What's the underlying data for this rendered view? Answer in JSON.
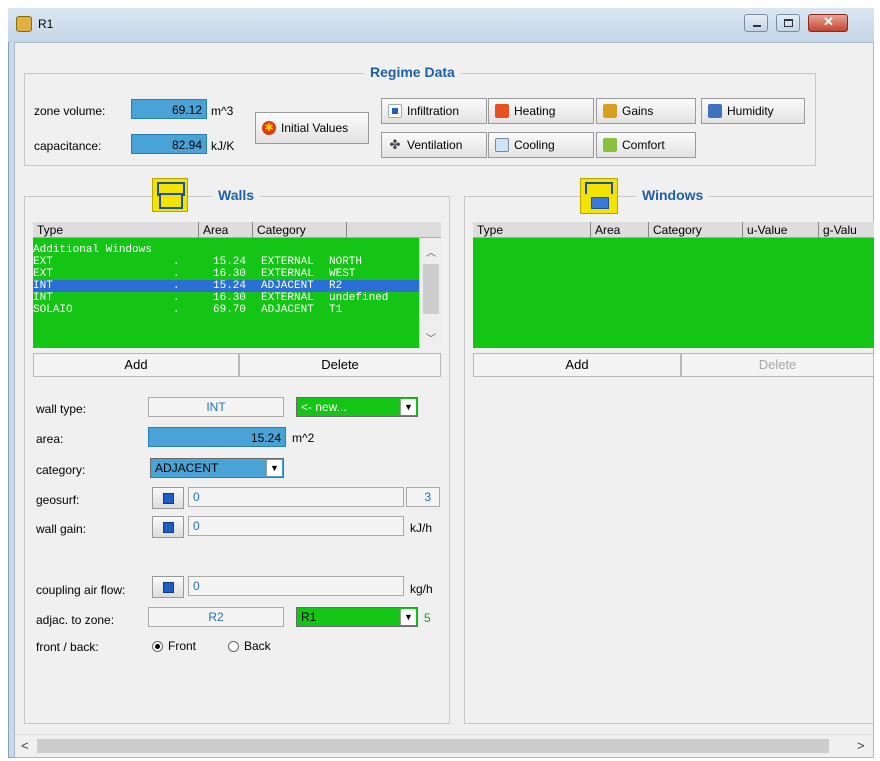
{
  "window": {
    "title": "R1"
  },
  "regime": {
    "legend": "Regime Data",
    "zone_volume_label": "zone volume:",
    "zone_volume_value": "69.12",
    "zone_volume_unit": "m^3",
    "capacitance_label": "capacitance:",
    "capacitance_value": "82.94",
    "capacitance_unit": "kJ/K",
    "initial_values": "Initial Values",
    "buttons": {
      "infiltration": "Infiltration",
      "heating": "Heating",
      "gains": "Gains",
      "humidity": "Humidity",
      "ventilation": "Ventilation",
      "cooling": "Cooling",
      "comfort": "Comfort"
    }
  },
  "walls": {
    "legend": "Walls",
    "columns": [
      "Type",
      "Area",
      "Category",
      ""
    ],
    "rows": [
      {
        "type": "Additional Windows",
        "dot": "",
        "area": "",
        "category": "",
        "extra": ""
      },
      {
        "type": "EXT",
        "dot": ".",
        "area": "15.24",
        "category": "EXTERNAL",
        "extra": "NORTH"
      },
      {
        "type": "EXT",
        "dot": ".",
        "area": "16.30",
        "category": "EXTERNAL",
        "extra": "WEST"
      },
      {
        "type": "INT",
        "dot": ".",
        "area": "15.24",
        "category": "ADJACENT",
        "extra": "R2"
      },
      {
        "type": "INT",
        "dot": ".",
        "area": "16.30",
        "category": "EXTERNAL",
        "extra": "undefined"
      },
      {
        "type": "SOLAIO",
        "dot": ".",
        "area": "69.70",
        "category": "ADJACENT",
        "extra": "T1"
      }
    ],
    "add": "Add",
    "delete": "Delete",
    "wall_type_label": "wall type:",
    "wall_type_value": "INT",
    "wall_type_new": "<- new...",
    "area_label": "area:",
    "area_value": "15.24",
    "area_unit": "m^2",
    "category_label": "category:",
    "category_value": "ADJACENT",
    "geosurf_label": "geosurf:",
    "geosurf_value": "0",
    "geosurf_count": "3",
    "wall_gain_label": "wall gain:",
    "wall_gain_value": "0",
    "wall_gain_unit": "kJ/h",
    "coupling_label": "coupling air flow:",
    "coupling_value": "0",
    "coupling_unit": "kg/h",
    "adjac_label": "adjac. to zone:",
    "adjac_value": "R2",
    "adjac_select": "R1",
    "adjac_count": "5",
    "front_back_label": "front / back:",
    "front": "Front",
    "back": "Back"
  },
  "windows": {
    "legend": "Windows",
    "columns": [
      "Type",
      "Area",
      "Category",
      "u-Value",
      "g-Valu"
    ],
    "add": "Add",
    "delete": "Delete"
  },
  "scrollbar": {
    "left": "<",
    "right": ">"
  }
}
